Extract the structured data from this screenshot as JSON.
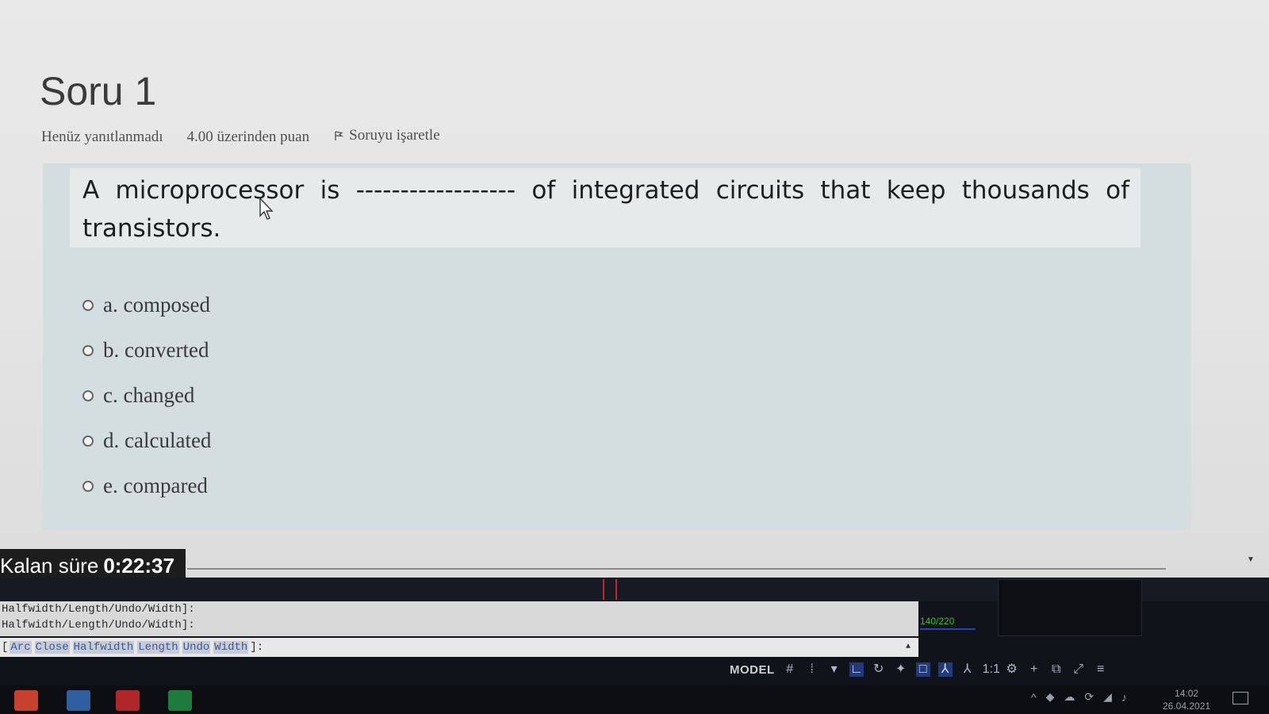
{
  "question": {
    "title": "Soru 1",
    "status": "Henüz yanıtlanmadı",
    "points": "4.00 üzerinden puan",
    "flag_label": "Soruyu işaretle",
    "text": "A microprocessor is ------------------ of integrated circuits that keep thousands of transistors.",
    "options": [
      {
        "label": "a. composed"
      },
      {
        "label": "b. converted"
      },
      {
        "label": "c. changed"
      },
      {
        "label": "d. calculated"
      },
      {
        "label": "e. compared"
      }
    ]
  },
  "timer": {
    "label": "Kalan süre",
    "value": "0:22:37"
  },
  "cad": {
    "history": [
      "Halfwidth/Length/Undo/Width]:",
      "Halfwidth/Length/Undo/Width]:"
    ],
    "prompt_open": "[",
    "prompt_options": [
      "Arc",
      "Close",
      "Halfwidth",
      "Length",
      "Undo",
      "Width"
    ],
    "prompt_close": "]:",
    "coords": "140/220",
    "status_model": "MODEL",
    "status_scale": "1:1"
  },
  "system": {
    "time": "14:02",
    "date": "26.04.2021"
  },
  "colors": {
    "question_box": "#d4dee0",
    "timer_bg": "#1d1d1d",
    "cad_bg": "#10131a",
    "coords_green": "#2cc42c"
  }
}
